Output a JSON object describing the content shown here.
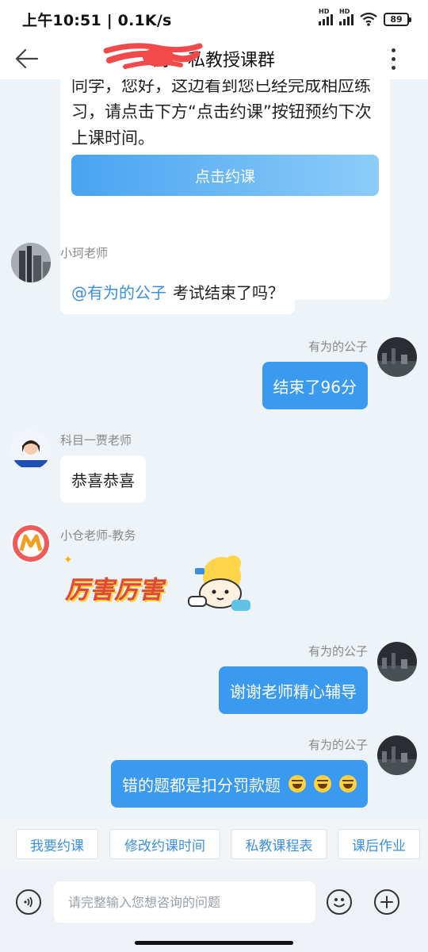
{
  "status_bar": {
    "time": "上午10:51 | 0.1K/s",
    "battery": "89",
    "signal_label": "HD"
  },
  "header": {
    "title": "对一私教授课群"
  },
  "messages": {
    "card": {
      "text": "同学，您好，这边看到您已经完成相应练习，请点击下方“点击约课”按钮预约下次上课时间。",
      "button_label": "点击约课"
    },
    "m1": {
      "sender": "小珂老师",
      "mention": "@有为的公子",
      "text": "考试结束了吗？"
    },
    "m2": {
      "sender": "有为的公子",
      "text": "结束了96分"
    },
    "m3": {
      "sender": "科目一贾老师",
      "text": "恭喜恭喜"
    },
    "m4": {
      "sender": "小仓老师-教务",
      "sticker_text": "厉害厉害"
    },
    "m5": {
      "sender": "有为的公子",
      "text": "谢谢老师精心辅导"
    },
    "m6": {
      "sender": "有为的公子",
      "text": "错的题都是扣分罚款题"
    }
  },
  "quick_actions": [
    "我要约课",
    "修改约课时间",
    "私教课程表",
    "课后作业"
  ],
  "input": {
    "placeholder": "请完整输入您想咨询的问题"
  },
  "colors": {
    "accent": "#3a9af0",
    "background": "#eef3f7",
    "link": "#3a8fe0"
  }
}
